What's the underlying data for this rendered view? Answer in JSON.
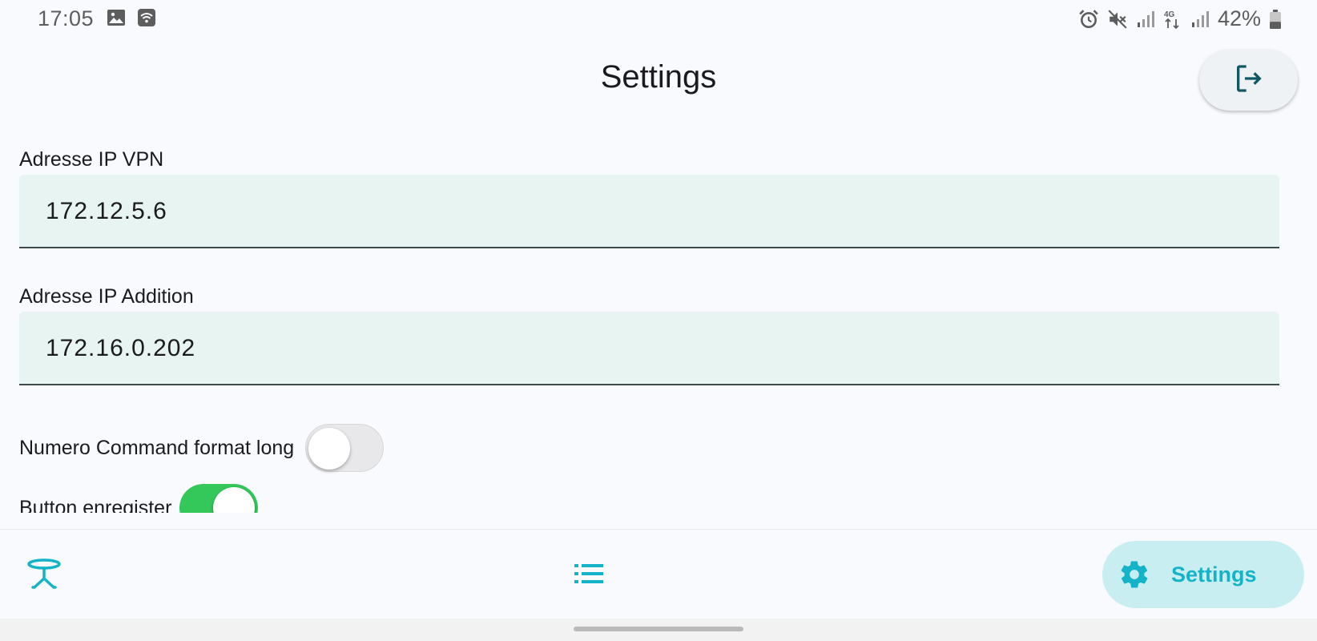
{
  "status_bar": {
    "time": "17:05",
    "left_icons": [
      "image-icon",
      "wifi-calling-icon"
    ],
    "right_icons": [
      "alarm-icon",
      "mute-icon",
      "signal-icon",
      "4g-icon",
      "signal-icon"
    ],
    "network_label": "4G",
    "battery_percent": "42%",
    "battery_level": 0.42
  },
  "header": {
    "title": "Settings",
    "logout_icon": "logout-icon"
  },
  "fields": [
    {
      "label": "Adresse IP VPN",
      "value": "172.12.5.6"
    },
    {
      "label": "Adresse IP Addition",
      "value": "172.16.0.202"
    }
  ],
  "toggles": [
    {
      "label": "Numero Command format long",
      "checked": false
    },
    {
      "label": "Button enregister",
      "checked": true
    }
  ],
  "bottom_nav": {
    "items": [
      {
        "icon": "table-icon",
        "label": ""
      },
      {
        "icon": "list-icon",
        "label": ""
      },
      {
        "icon": "gear-icon",
        "label": "Settings",
        "active": true
      }
    ]
  },
  "colors": {
    "accent": "#15b3c8",
    "active_pill": "#c9eef2",
    "field_bg": "#e7f4f1",
    "toggle_on": "#34c759",
    "background": "#f8fafd"
  }
}
